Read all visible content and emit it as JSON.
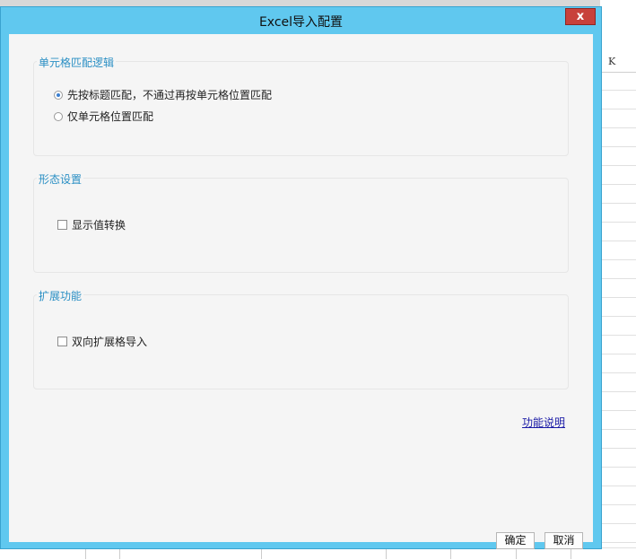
{
  "dialog": {
    "title": "Excel导入配置",
    "close_label": "x"
  },
  "background": {
    "column_letter": "K"
  },
  "groups": {
    "cell_matching": {
      "title": "单元格匹配逻辑",
      "options": [
        {
          "label": "先按标题匹配，不通过再按单元格位置匹配",
          "selected": true
        },
        {
          "label": "仅单元格位置匹配",
          "selected": false
        }
      ]
    },
    "display": {
      "title": "形态设置",
      "checkbox_label": "显示值转换",
      "checked": false
    },
    "extension": {
      "title": "扩展功能",
      "checkbox_label": "双向扩展格导入",
      "checked": false
    }
  },
  "help_link": "功能说明",
  "buttons": {
    "ok": "确定",
    "cancel": "取消"
  },
  "colors": {
    "frame": "#60c8ef",
    "group_title": "#2a8fc4",
    "close": "#c8413b"
  }
}
